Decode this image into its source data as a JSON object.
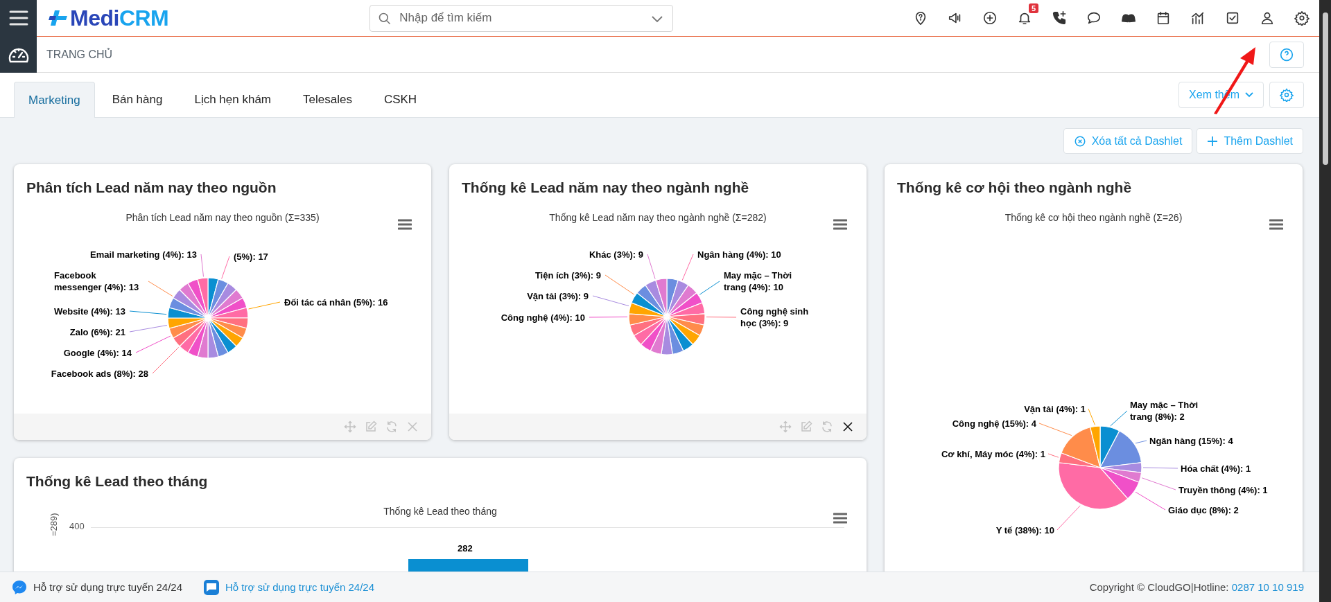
{
  "header": {
    "logo": {
      "parts": [
        "Medi",
        "CRM"
      ]
    },
    "search": {
      "placeholder": "Nhập để tìm kiếm"
    },
    "notifications": {
      "count": "5"
    }
  },
  "breadcrumb": {
    "title": "TRANG CHỦ"
  },
  "tabs": [
    {
      "label": "Marketing",
      "selected": true
    },
    {
      "label": "Bán hàng",
      "selected": false
    },
    {
      "label": "Lịch hẹn khám",
      "selected": false
    },
    {
      "label": "Telesales",
      "selected": false
    },
    {
      "label": "CSKH",
      "selected": false
    }
  ],
  "more_button": {
    "label": "Xem thêm"
  },
  "actions": [
    {
      "kind": "remove",
      "label": "Xóa tất cả Dashlet"
    },
    {
      "kind": "add",
      "label": "Thêm Dashlet"
    }
  ],
  "dashlets": [
    {
      "kind": "pie_picture",
      "title": "Phân tích Lead năm nay theo nguồn",
      "chart_title": "Phân tích Lead năm nay theo nguồn (Σ=335)",
      "slice_labels": [
        "Email marketing (4%): 13",
        "(5%): 17",
        "Facebook messenger (4%): 13",
        "Website (4%): 13",
        "Zalo (6%): 21",
        "Google (4%): 14",
        "Facebook ads (8%): 28",
        "Đối tác cá nhân (5%): 16"
      ],
      "toolbar": {
        "close_highlighted": false
      }
    },
    {
      "kind": "pie_picture",
      "title": "Thống kê Lead năm nay theo ngành nghề",
      "chart_title": "Thống kê Lead năm nay theo ngành nghề (Σ=282)",
      "slice_labels": [
        "Khác (3%): 9",
        "Ngân hàng (4%): 10",
        "Tiện ích (3%): 9",
        "May mặc – Thời trang (4%): 10",
        "Vận tải (3%): 9",
        "Công nghệ (4%): 10",
        "Công nghệ sinh học (3%): 9"
      ],
      "toolbar": {
        "close_highlighted": true
      }
    },
    {
      "kind": "pie_chart",
      "title": "Thống kê cơ hội theo ngành nghề",
      "chart_data": {
        "type": "pie",
        "title": "Thống kê cơ hội theo ngành nghề (Σ=26)",
        "values": [
          2,
          4,
          1,
          1,
          2,
          10,
          1,
          4,
          1
        ],
        "value_labels": [
          "May mặc – Thời trang (8%): 2",
          "Ngân hàng (15%): 4",
          "Hóa chất (4%): 1",
          "Truyền thông (4%): 1",
          "Giáo dục (8%): 2",
          "Y tế (38%): 10",
          "Cơ khí, Máy móc (4%): 1",
          "Công nghệ (15%): 4",
          "Vận tải (4%): 1"
        ]
      }
    },
    {
      "kind": "bar_picture",
      "title": "Thống kê Lead theo tháng",
      "chart_title": "Thống kê Lead theo tháng",
      "y_tick": "400",
      "axis_label": "=289)",
      "bar_label": "282"
    }
  ],
  "footer": {
    "support": [
      {
        "kind": "messenger",
        "text": "Hỗ trợ sử dụng trực tuyến 24/24"
      },
      {
        "kind": "zalo",
        "text": "Hỗ trợ sử dụng trực tuyến 24/24"
      }
    ],
    "copyright": "Copyright © CloudGO|Hotline: ",
    "hotline": "0287 10 10 919"
  }
}
